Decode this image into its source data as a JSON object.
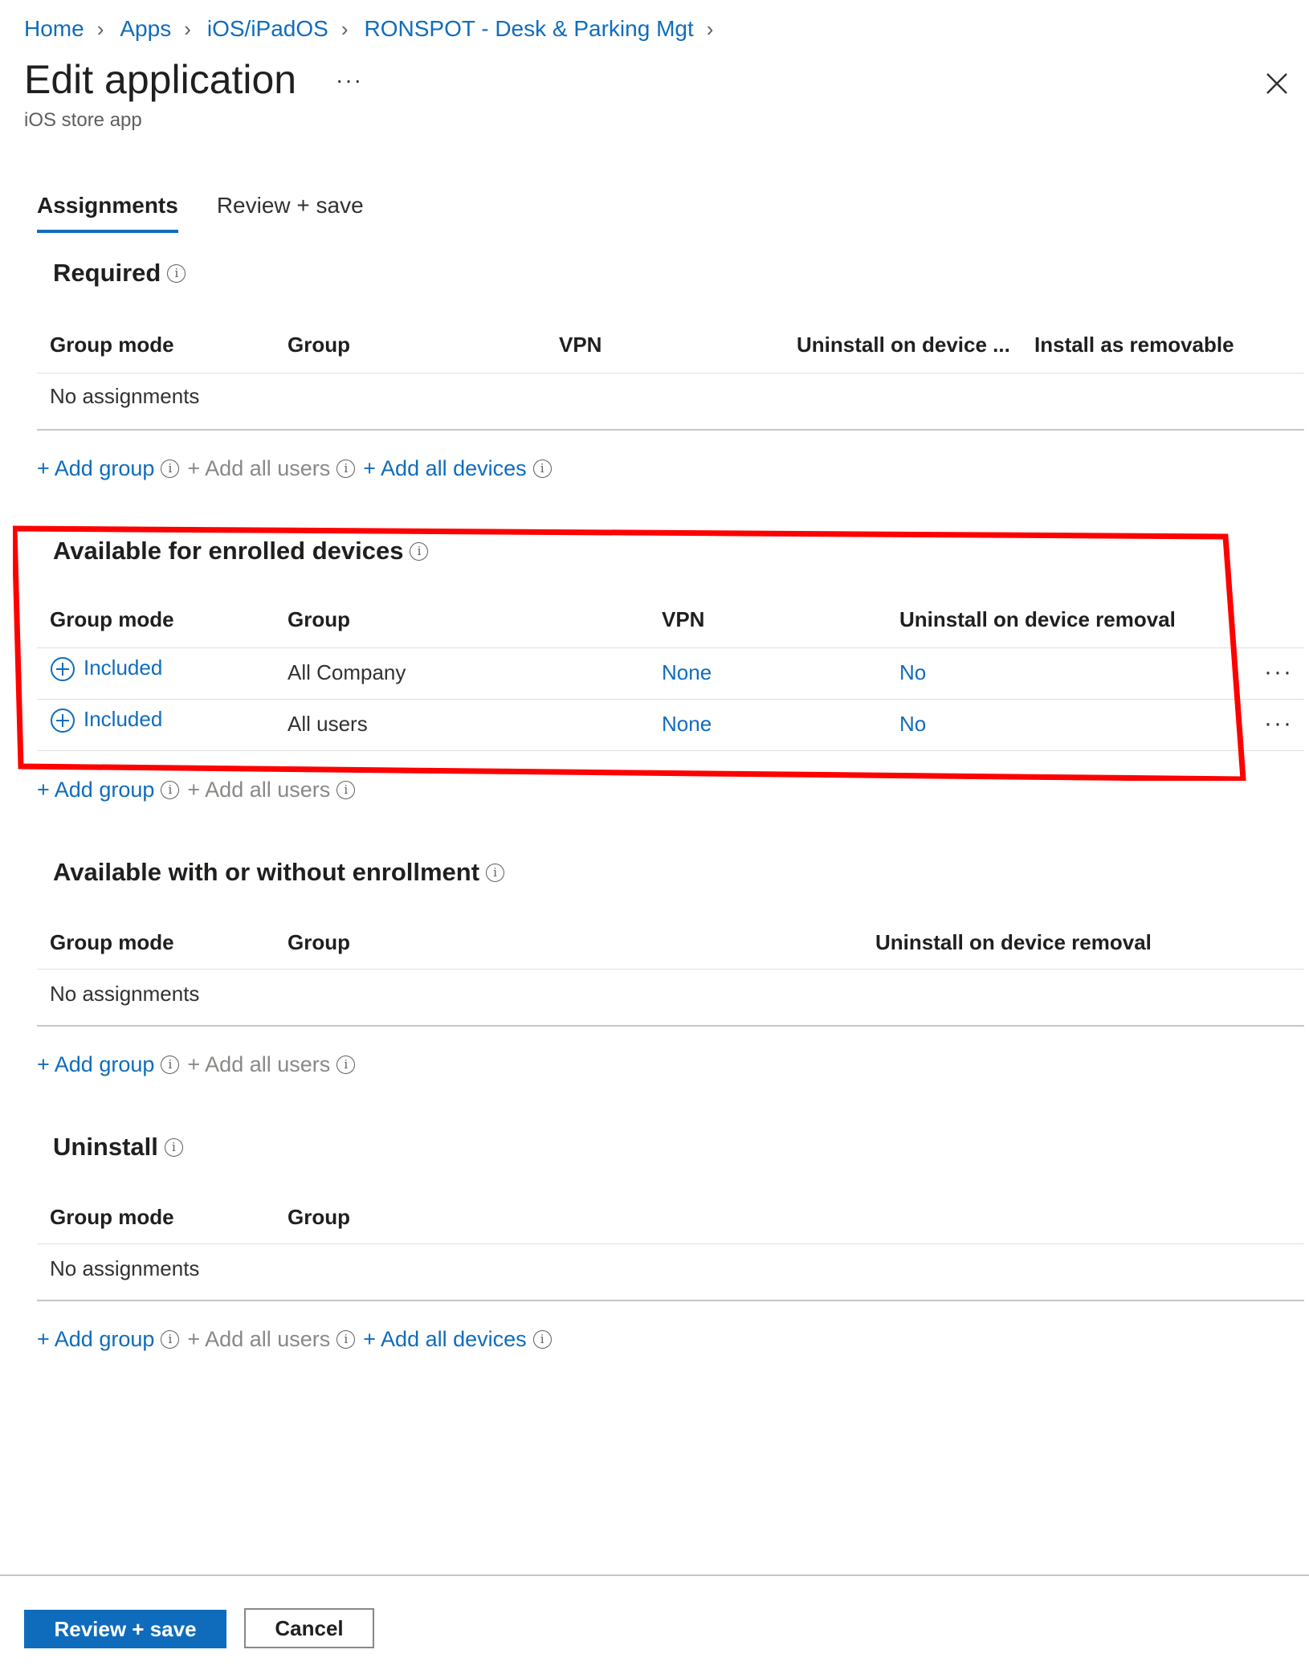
{
  "breadcrumb": [
    "Home",
    "Apps",
    "iOS/iPadOS",
    "RONSPOT - Desk & Parking Mgt"
  ],
  "title": "Edit application",
  "more": "···",
  "subtitle": "iOS store app",
  "tabs": [
    "Assignments",
    "Review + save"
  ],
  "required": {
    "title": "Required",
    "headers": [
      "Group mode",
      "Group",
      "VPN",
      "Uninstall on device ...",
      "Install as removable"
    ],
    "empty": "No assignments",
    "actions": [
      "+ Add group",
      "+ Add all users",
      "+ Add all devices"
    ]
  },
  "enrolled": {
    "title": "Available for enrolled devices",
    "headers": [
      "Group mode",
      "Group",
      "VPN",
      "Uninstall on device removal"
    ],
    "rows": [
      {
        "mode": "Included",
        "group": "All Company",
        "vpn": "None",
        "uninstall": "No"
      },
      {
        "mode": "Included",
        "group": "All users",
        "vpn": "None",
        "uninstall": "No"
      }
    ],
    "row_menu": "···",
    "actions": [
      "+ Add group",
      "+ Add all users"
    ]
  },
  "without_enrollment": {
    "title": "Available with or without enrollment",
    "headers": [
      "Group mode",
      "Group",
      "Uninstall on device removal"
    ],
    "empty": "No assignments",
    "actions": [
      "+ Add group",
      "+ Add all users"
    ]
  },
  "uninstall": {
    "title": "Uninstall",
    "headers": [
      "Group mode",
      "Group"
    ],
    "empty": "No assignments",
    "actions": [
      "+ Add group",
      "+ Add all users",
      "+ Add all devices"
    ]
  },
  "footer": {
    "primary": "Review + save",
    "secondary": "Cancel"
  },
  "colors": {
    "link": "#0f6cbd",
    "annotation": "#ff0000"
  }
}
